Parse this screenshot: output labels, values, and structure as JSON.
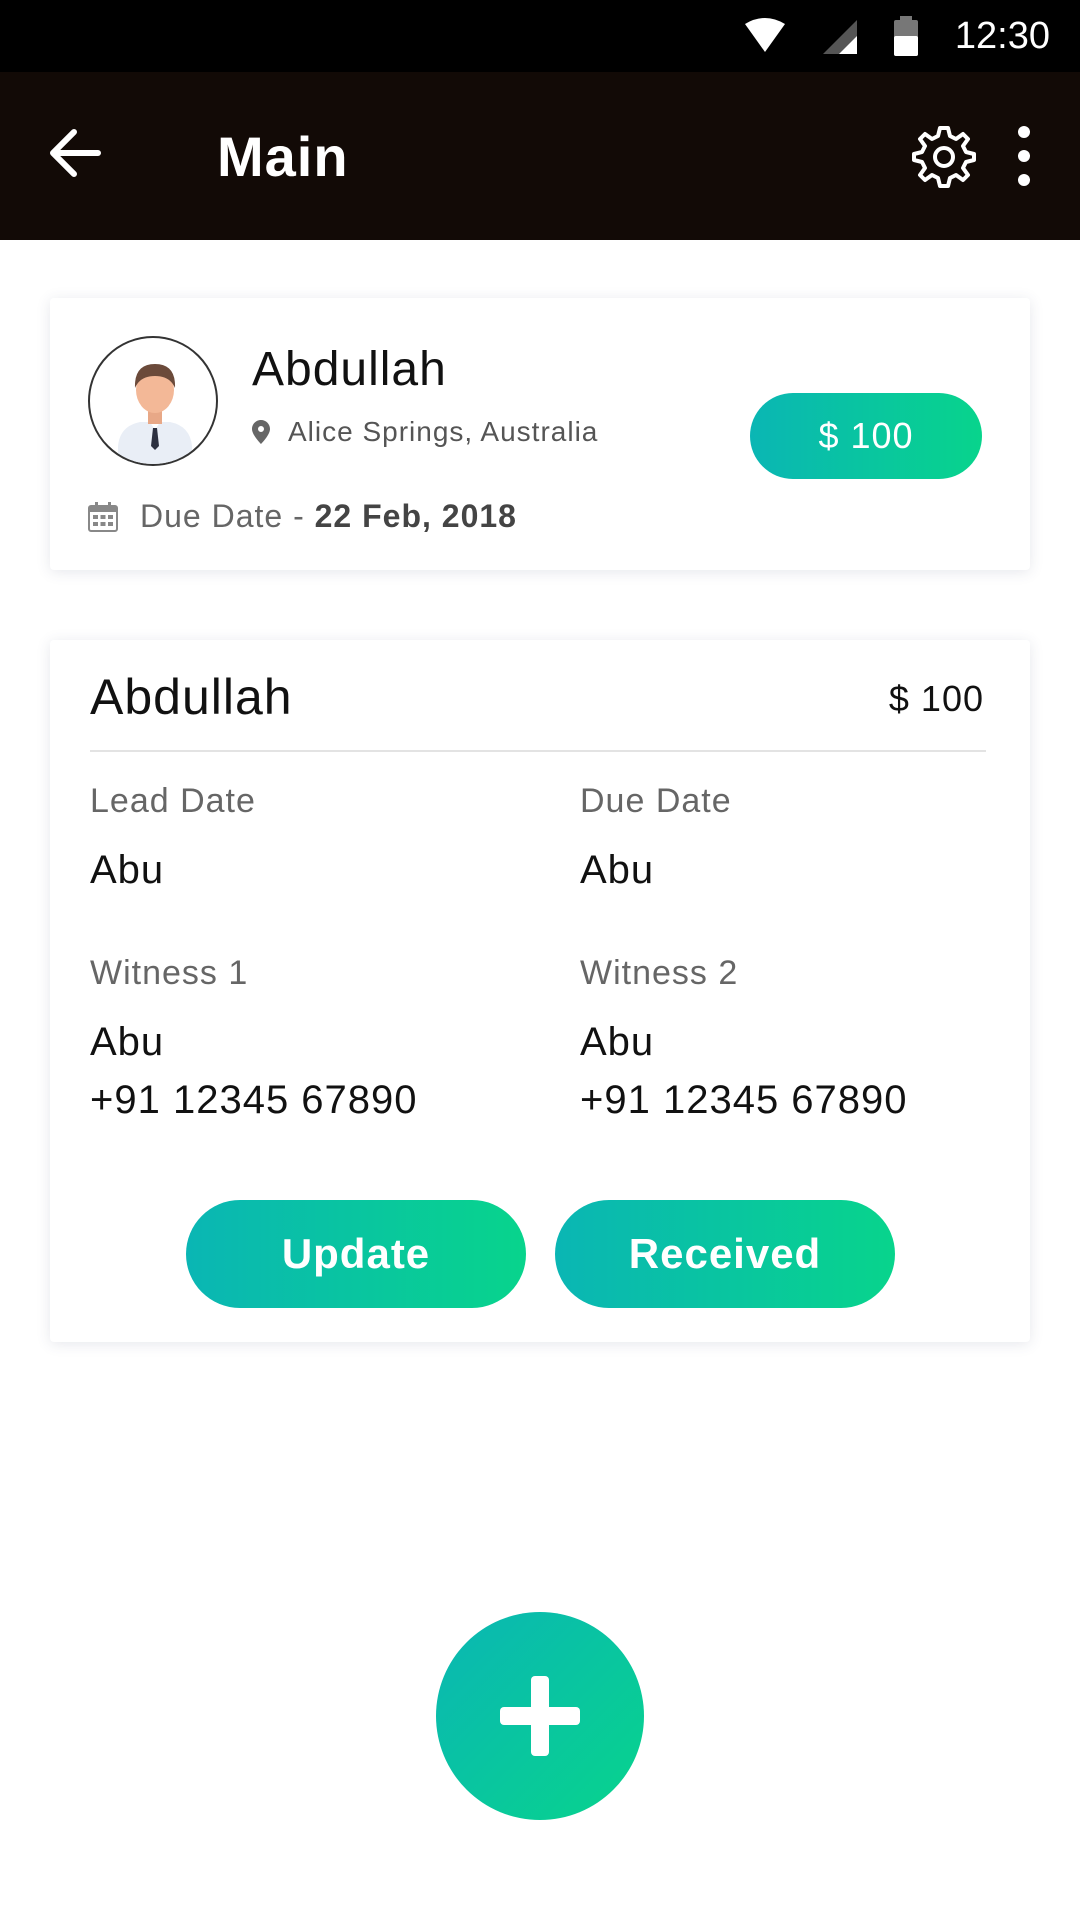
{
  "status_bar": {
    "time": "12:30"
  },
  "toolbar": {
    "title": "Main"
  },
  "summary_card": {
    "name": "Abdullah",
    "location": "Alice Springs, Australia",
    "amount": "$ 100",
    "due_label": "Due Date - ",
    "due_date": "22 Feb, 2018"
  },
  "detail_card": {
    "name": "Abdullah",
    "amount": "$ 100",
    "lead_date_label": "Lead Date",
    "lead_date_value": "Abu",
    "due_date_label": "Due Date",
    "due_date_value": "Abu",
    "witness1_label": "Witness 1",
    "witness1_name": "Abu",
    "witness1_phone": "+91 12345 67890",
    "witness2_label": "Witness 2",
    "witness2_name": "Abu",
    "witness2_phone": "+91 12345 67890",
    "update_label": "Update",
    "received_label": "Received"
  },
  "colors": {
    "toolbar": "#120a06",
    "gradient_start": "#0ab6b4",
    "gradient_end": "#08d48c"
  }
}
